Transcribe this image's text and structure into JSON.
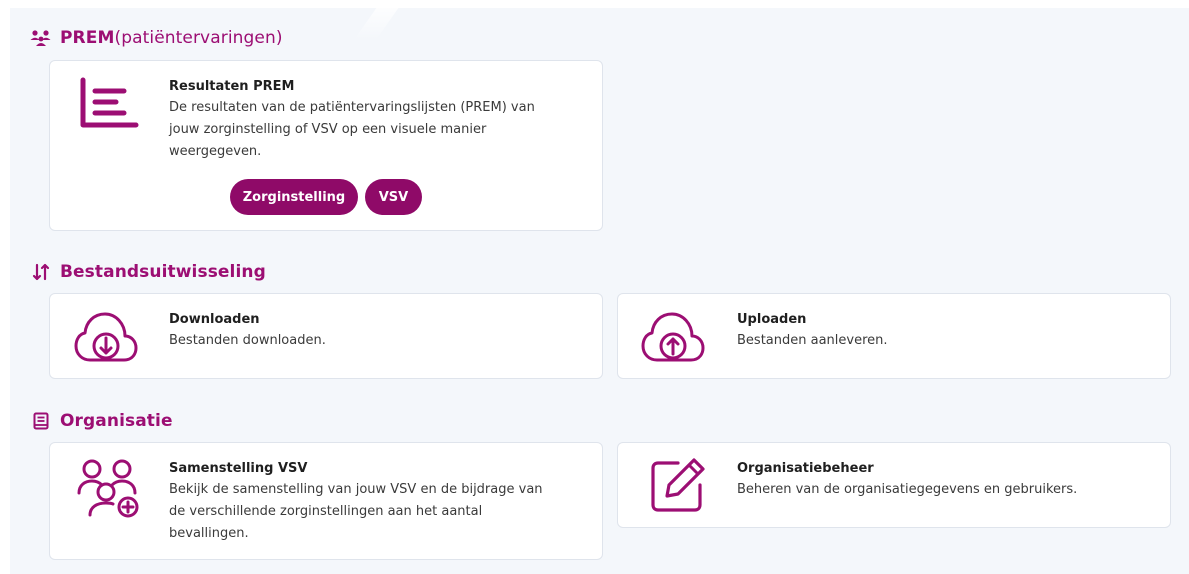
{
  "colors": {
    "accent": "#9c0e73",
    "button": "#8f0a68",
    "background": "#f4f7fb"
  },
  "sections": {
    "prem": {
      "title_main": "PREM ",
      "title_paren": "(patiëntervaringen)",
      "icon": "users-icon",
      "card": {
        "icon": "chart-list-icon",
        "title": "Resultaten PREM",
        "desc_lines": [
          "De resultaten van de patiëntervaringslijsten (PREM) van",
          "jouw zorginstelling of VSV op een visuele manier",
          "weergegeven."
        ],
        "buttons": [
          "Zorginstelling",
          "VSV"
        ]
      }
    },
    "exchange": {
      "title": "Bestandsuitwisseling",
      "icon": "sort-arrows-icon",
      "download": {
        "icon": "cloud-download-icon",
        "title": "Downloaden",
        "desc": "Bestanden downloaden."
      },
      "upload": {
        "icon": "cloud-upload-icon",
        "title": "Uploaden",
        "desc": "Bestanden aanleveren."
      }
    },
    "organisation": {
      "title": "Organisatie",
      "icon": "book-icon",
      "composition": {
        "icon": "users-plus-icon",
        "title": "Samenstelling VSV",
        "desc_lines": [
          "Bekijk de samenstelling van jouw VSV en de bijdrage van",
          "de verschillende zorginstellingen aan het aantal",
          "bevallingen."
        ]
      },
      "management": {
        "icon": "edit-icon",
        "title": "Organisatiebeheer",
        "desc": "Beheren van de organisatiegegevens en gebruikers."
      }
    }
  }
}
